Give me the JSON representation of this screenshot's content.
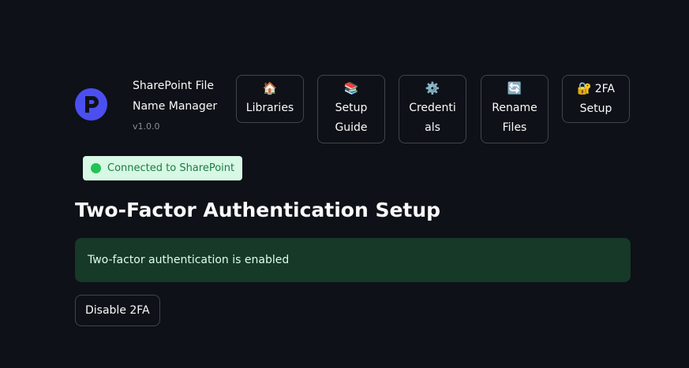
{
  "app": {
    "title": "SharePoint File Name Manager",
    "version": "v1.0.0",
    "logo_icon": "p-logo-icon",
    "logo_color": "#4b4ff0"
  },
  "nav": [
    {
      "icon": "🏠",
      "icon_name": "house-icon",
      "label": "Libraries"
    },
    {
      "icon": "📚",
      "icon_name": "books-icon",
      "label": "Setup Guide"
    },
    {
      "icon": "⚙️",
      "icon_name": "gear-icon",
      "label": "Credentials"
    },
    {
      "icon": "🔄",
      "icon_name": "refresh-icon",
      "label": "Rename Files"
    },
    {
      "icon": "🔐",
      "icon_name": "lock-key-icon",
      "label": "2FA Setup"
    }
  ],
  "status": {
    "text": "Connected to SharePoint",
    "dot_color": "#21c354",
    "bg_color": "#d7f8e4"
  },
  "page": {
    "title": "Two-Factor Authentication Setup",
    "alert_text": "Two-factor authentication is enabled",
    "alert_bg": "#173928",
    "disable_button": "Disable 2FA"
  }
}
